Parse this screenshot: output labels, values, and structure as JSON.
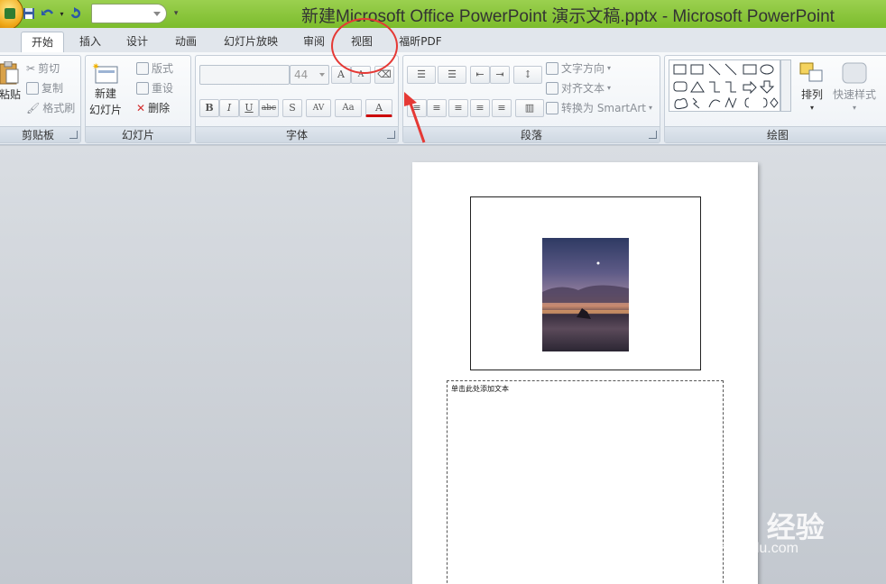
{
  "window": {
    "title": "新建Microsoft Office PowerPoint 演示文稿.pptx - Microsoft PowerPoint"
  },
  "tabs": [
    {
      "label": "开始",
      "active": true
    },
    {
      "label": "插入"
    },
    {
      "label": "设计"
    },
    {
      "label": "动画"
    },
    {
      "label": "幻灯片放映"
    },
    {
      "label": "审阅"
    },
    {
      "label": "视图"
    },
    {
      "label": "福昕PDF"
    }
  ],
  "clipboard": {
    "paste": "粘贴",
    "cut": "剪切",
    "copy": "复制",
    "format_painter": "格式刷",
    "label": "剪贴板"
  },
  "slides": {
    "new_slide_line1": "新建",
    "new_slide_line2": "幻灯片",
    "layout": "版式",
    "reset": "重设",
    "delete": "删除",
    "label": "幻灯片"
  },
  "font": {
    "font_name": "",
    "font_size": "44",
    "label": "字体"
  },
  "paragraph": {
    "text_direction": "文字方向",
    "align_text": "对齐文本",
    "smartart": "转换为 SmartArt",
    "label": "段落"
  },
  "drawing": {
    "arrange": "排列",
    "quick_styles": "快速样式",
    "label": "绘图"
  },
  "notes": {
    "placeholder": "单击此处添加文本"
  },
  "watermark": {
    "main": "Baidu 经验",
    "sub": "jingyan.baidu.com"
  },
  "colors": {
    "title_bar": "#8cc63e",
    "annotation": "#e53935"
  }
}
